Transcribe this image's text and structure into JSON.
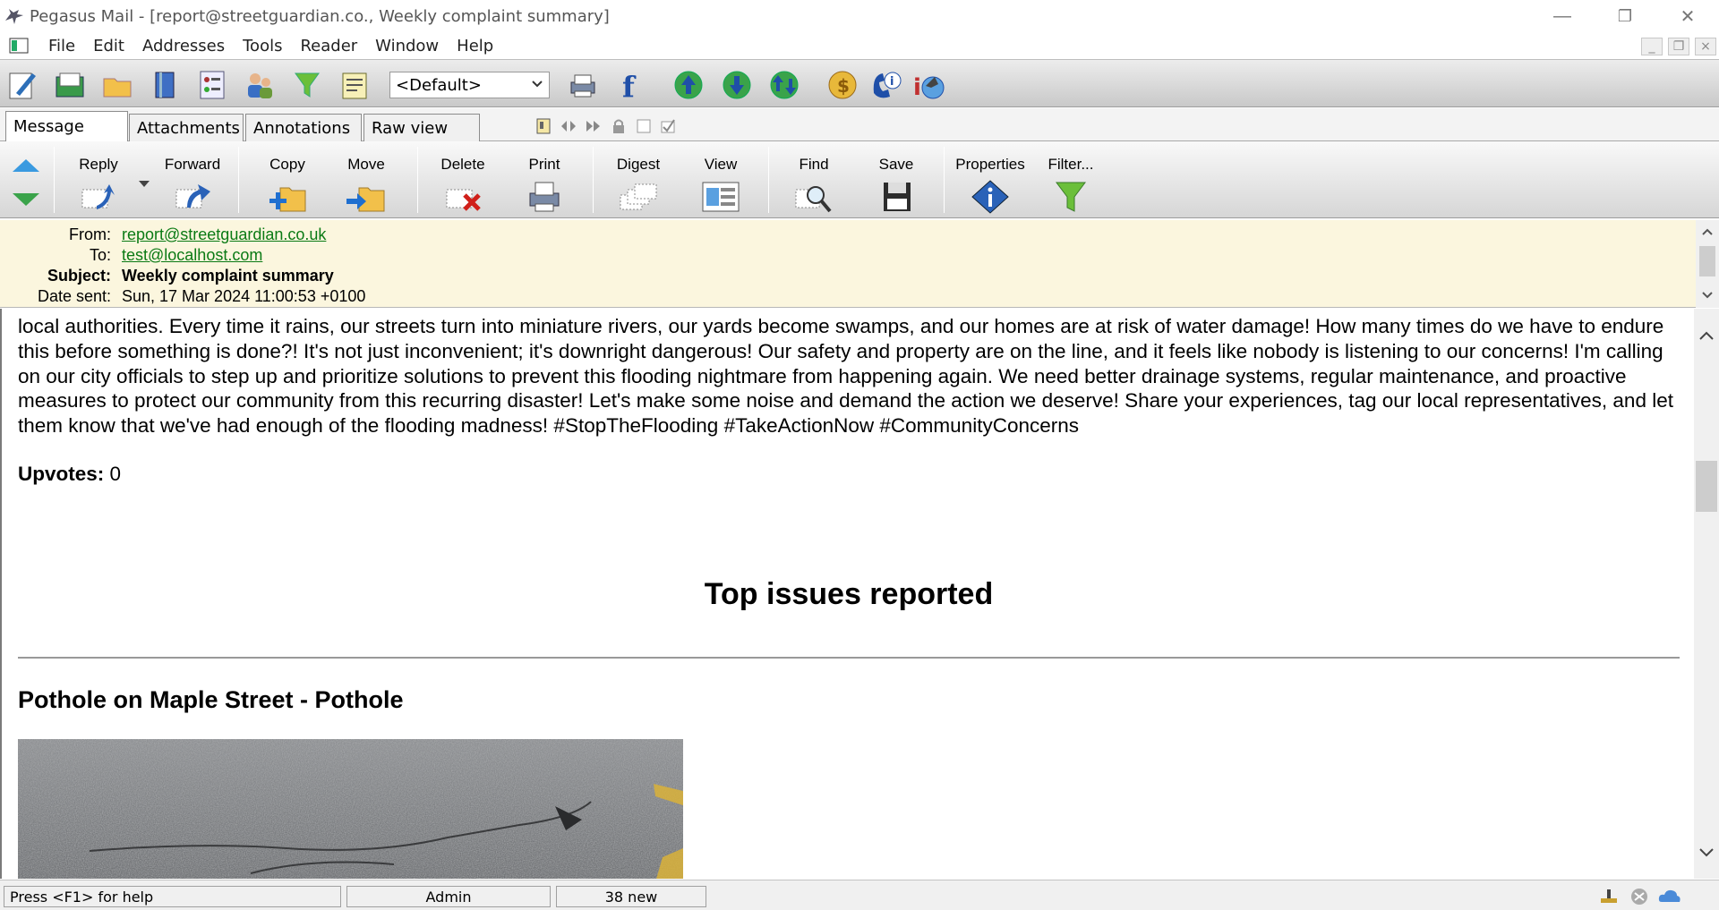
{
  "window": {
    "title": "Pegasus Mail - [report@streetguardian.co., Weekly complaint summary]",
    "minimize_glyph": "—",
    "restore_glyph": "❐",
    "close_glyph": "✕"
  },
  "menu": {
    "items": [
      "File",
      "Edit",
      "Addresses",
      "Tools",
      "Reader",
      "Window",
      "Help"
    ],
    "mdi_minimize": "_",
    "mdi_restore": "❐",
    "mdi_close": "×"
  },
  "toolbar": {
    "icons": [
      "compose-icon",
      "inbox-icon",
      "folders-icon",
      "addressbook-icon",
      "distribution-list-icon",
      "users-icon",
      "filter-icon",
      "noticeboard-icon",
      "print-icon",
      "font-icon",
      "check-mail-icon",
      "send-mail-icon",
      "send-check-mail-icon",
      "coins-icon",
      "help-icon",
      "about-icon"
    ],
    "identity_select": "<Default>"
  },
  "tabs": [
    {
      "label": "Message",
      "active": true
    },
    {
      "label": "Attachments",
      "active": false
    },
    {
      "label": "Annotations",
      "active": false
    },
    {
      "label": "Raw view",
      "active": false
    }
  ],
  "actions": [
    {
      "label": "Reply",
      "icon": "reply-icon"
    },
    {
      "label": "Forward",
      "icon": "forward-icon"
    },
    {
      "label": "Copy",
      "icon": "copy-icon"
    },
    {
      "label": "Move",
      "icon": "move-icon"
    },
    {
      "label": "Delete",
      "icon": "delete-icon"
    },
    {
      "label": "Print",
      "icon": "print-icon"
    },
    {
      "label": "Digest",
      "icon": "digest-icon"
    },
    {
      "label": "View",
      "icon": "view-icon"
    },
    {
      "label": "Find",
      "icon": "find-icon"
    },
    {
      "label": "Save",
      "icon": "save-icon"
    },
    {
      "label": "Properties",
      "icon": "properties-icon"
    },
    {
      "label": "Filter...",
      "icon": "filter-icon"
    }
  ],
  "header": {
    "from_label": "From:",
    "from_value": "report@streetguardian.co.uk",
    "to_label": "To:",
    "to_value": "test@localhost.com",
    "subject_label": "Subject:",
    "subject_value": "Weekly complaint summary",
    "date_label": "Date sent:",
    "date_value": "Sun, 17 Mar 2024 11:00:53 +0100"
  },
  "message": {
    "body_text": "local authorities. Every time it rains, our streets turn into miniature rivers, our yards become swamps, and our homes are at risk of water damage! How many times do we have to endure this before something is done?! It's not just inconvenient; it's downright dangerous! Our safety and property are on the line, and it feels like nobody is listening to our concerns! I'm calling on our city officials to step up and prioritize solutions to prevent this flooding nightmare from happening again. We need better drainage systems, regular maintenance, and proactive measures to protect our community from this recurring disaster! Let's make some noise and demand the action we deserve! Share your experiences, tag our local representatives, and let them know that we've had enough of the flooding madness! #StopTheFlooding #TakeActionNow #CommunityConcerns",
    "upvotes_label": "Upvotes:",
    "upvotes_value": "0",
    "section_title": "Top issues reported",
    "issue_title": "Pothole on Maple Street - Pothole"
  },
  "status": {
    "help": "Press <F1> for help",
    "user": "Admin",
    "new_count": "38 new"
  },
  "colors": {
    "header_bg": "#fbf6de",
    "link": "#0a7a14"
  }
}
